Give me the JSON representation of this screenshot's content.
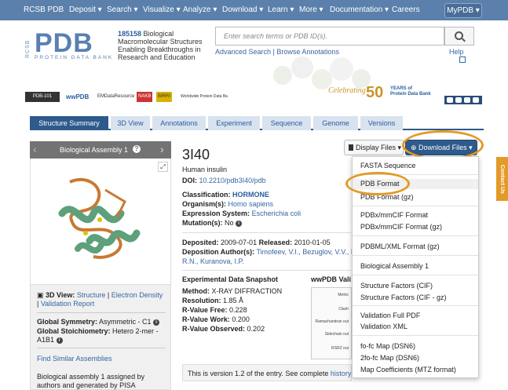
{
  "nav": {
    "items": [
      "RCSB PDB",
      "Deposit ▾",
      "Search ▾",
      "Visualize ▾",
      "Analyze ▾",
      "Download ▾",
      "Learn ▾",
      "More ▾",
      "Documentation ▾",
      "Careers"
    ],
    "mypdb": "MyPDB ▾"
  },
  "header": {
    "logo_rcsb": "RCSB",
    "logo_pdb": "PDB",
    "logo_sub": "PROTEIN DATA BANK",
    "tagline_number": "185158",
    "tagline_text": " Biological Macromolecular Structures Enabling Breakthroughs in Research and Education",
    "search_placeholder": "Enter search terms or PDB ID(s).",
    "advanced_search": "Advanced Search",
    "separator": " | ",
    "browse_annotations": "Browse Annotations",
    "help": "Help",
    "partners": [
      "PDB-101",
      "wwPDB",
      "EMDataResource",
      "NAKB",
      "BIRRI",
      "Worldwide Protein Data Bank Foundation"
    ],
    "celebrating": "Celebrating",
    "fifty": "50",
    "years_line1": "YEARS of",
    "years_line2": "Protein Data Bank"
  },
  "tabs": [
    "Structure Summary",
    "3D View",
    "Annotations",
    "Experiment",
    "Sequence",
    "Genome",
    "Versions"
  ],
  "assembly": {
    "title": "Biological Assembly 1",
    "view_label": "3D View:",
    "structure_link": "Structure",
    "electron_link": "Electron Density",
    "validation_link": "Validation Report",
    "symmetry_label": "Global Symmetry:",
    "symmetry_value": "Asymmetric - C1",
    "stoich_label": "Global Stoichiometry:",
    "stoich_value": "Hetero 2-mer - A1B1",
    "similar": "Find Similar Assemblies",
    "pisa": "Biological assembly 1 assigned by authors and generated by PISA"
  },
  "entry": {
    "id": "3I40",
    "name": "Human insulin",
    "doi_label": "DOI:",
    "doi": "10.2210/pdb3I40/pdb",
    "classification_label": "Classification:",
    "classification": "HORMONE",
    "organism_label": "Organism(s):",
    "organism": "Homo sapiens",
    "expression_label": "Expression System:",
    "expression": "Escherichia coli",
    "mutation_label": "Mutation(s):",
    "mutation": "No",
    "deposited_label": "Deposited:",
    "deposited": "2009-07-01",
    "released_label": "Released:",
    "released": "2010-01-05",
    "authors_label": "Deposition Author(s):",
    "authors_line1": "Timofeev, V.I., Bezuglov, V.V., M",
    "authors_line2": "R.N., Kuranova, I.P."
  },
  "snapshot": {
    "title": "Experimental Data Snapshot",
    "method_label": "Method:",
    "method": "X-RAY DIFFRACTION",
    "resolution_label": "Resolution:",
    "resolution": "1.85 Å",
    "rfree_label": "R-Value Free:",
    "rfree": "0.228",
    "rwork_label": "R-Value Work:",
    "rwork": "0.200",
    "robs_label": "R-Value Observed:",
    "robs": "0.202",
    "wwpdb_title": "wwPDB Vali",
    "metrics": [
      "Metric",
      "Clash",
      "Ramachandran out",
      "Sidechain out",
      "RSRZ out"
    ]
  },
  "version_text": "This is version 1.2 of the entry. See complete ",
  "version_link": "history",
  "buttons": {
    "display_files": "Display Files ▾",
    "download_files": "⊕ Download Files ▾"
  },
  "download_menu": [
    "FASTA Sequence",
    "PDB Format",
    "PDB Format (gz)",
    "PDBx/mmCIF Format",
    "PDBx/mmCIF Format (gz)",
    "PDBML/XML Format (gz)",
    "Biological Assembly 1",
    "Structure Factors (CIF)",
    "Structure Factors (CIF - gz)",
    "Validation Full PDF",
    "Validation XML",
    "fo-fc Map (DSN6)",
    "2fo-fc Map (DSN6)",
    "Map Coefficients (MTZ format)"
  ],
  "contact_us": "Contact Us",
  "colors": {
    "nav": "#5b80ab",
    "tab_active": "#2e5a8c",
    "highlight_ring": "#e39a27",
    "link": "#3466a3"
  }
}
